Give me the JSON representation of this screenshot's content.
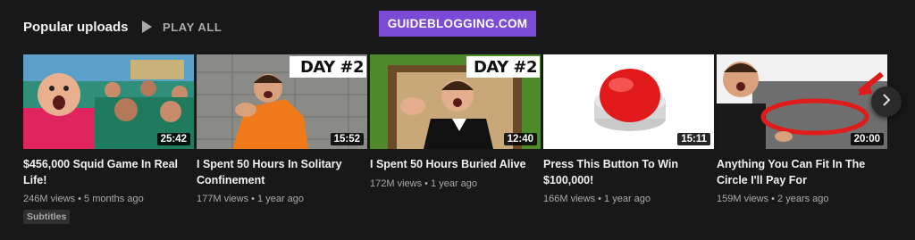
{
  "section": {
    "title": "Popular uploads",
    "play_all_label": "PLAY ALL"
  },
  "watermark": "GUIDEBLOGGING.COM",
  "videos": [
    {
      "title": "$456,000 Squid Game In Real Life!",
      "duration": "25:42",
      "views": "246M views",
      "age": "5 months ago",
      "badge": "Subtitles",
      "overlay": ""
    },
    {
      "title": "I Spent 50 Hours In Solitary Confinement",
      "duration": "15:52",
      "views": "177M views",
      "age": "1 year ago",
      "overlay": "DAY #2"
    },
    {
      "title": "I Spent 50 Hours Buried Alive",
      "duration": "12:40",
      "views": "172M views",
      "age": "1 year ago",
      "overlay": "DAY #2"
    },
    {
      "title": "Press This Button To Win $100,000!",
      "duration": "15:11",
      "views": "166M views",
      "age": "1 year ago",
      "overlay": ""
    },
    {
      "title": "Anything You Can Fit In The Circle I'll Pay For",
      "duration": "20:00",
      "views": "159M views",
      "age": "2 years ago",
      "overlay": ""
    }
  ],
  "icons": {
    "play": "play-icon",
    "next": "chevron-right-icon"
  },
  "colors": {
    "background": "#181818",
    "watermark_bg": "#7b4bd8",
    "meta_text": "#aaaaaa"
  }
}
